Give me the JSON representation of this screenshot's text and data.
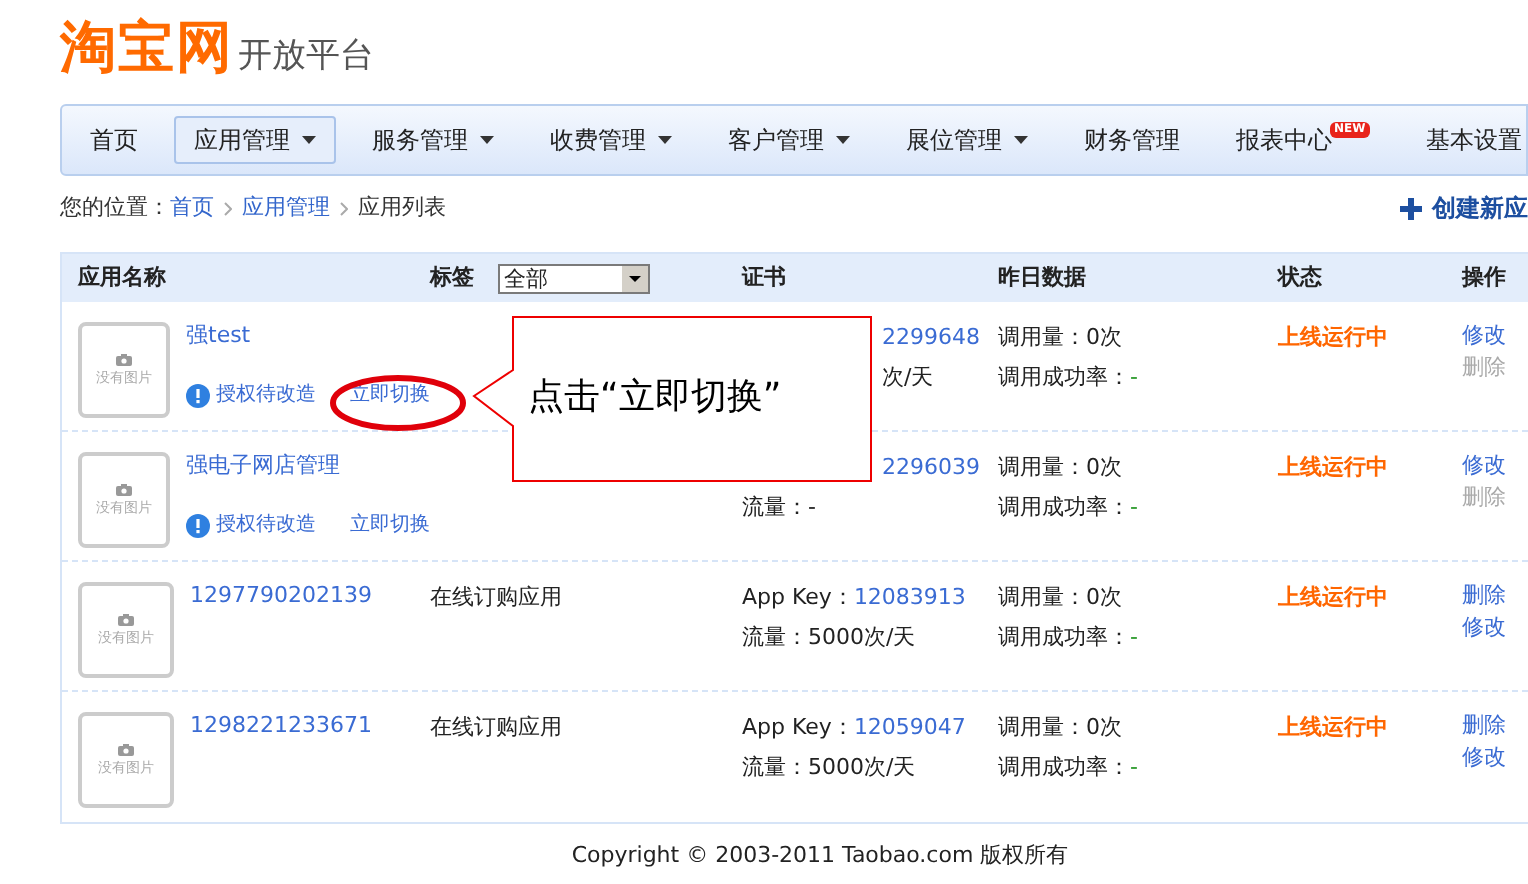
{
  "logo": {
    "brand": "淘宝网",
    "product": "开放平台"
  },
  "nav": [
    {
      "label": "首页",
      "selected": false,
      "dropdown": false
    },
    {
      "label": "应用管理",
      "selected": true,
      "dropdown": true
    },
    {
      "label": "服务管理",
      "selected": false,
      "dropdown": true
    },
    {
      "label": "收费管理",
      "selected": false,
      "dropdown": true
    },
    {
      "label": "客户管理",
      "selected": false,
      "dropdown": true
    },
    {
      "label": "展位管理",
      "selected": false,
      "dropdown": true
    },
    {
      "label": "财务管理",
      "selected": false,
      "dropdown": false
    },
    {
      "label": "报表中心",
      "selected": false,
      "dropdown": false,
      "badge": "NEW"
    },
    {
      "label": "基本设置",
      "selected": false,
      "dropdown": false
    }
  ],
  "breadcrumb": {
    "prefix": "您的位置：",
    "links": [
      "首页",
      "应用管理"
    ],
    "current": "应用列表"
  },
  "create_button": "创建新应",
  "table": {
    "columns": [
      "应用名称",
      "标签",
      "证书",
      "昨日数据",
      "状态",
      "操作"
    ],
    "tag_filter": "全部",
    "rows": [
      {
        "thumb": "没有图片",
        "name": "强test",
        "auth": "授权待改造",
        "switch": "立即切换",
        "cert": {
          "key": "2299648",
          "flow": "次/天"
        },
        "calls": "调用量：0次",
        "rate_label": "调用成功率：",
        "rate": "-",
        "status": "上线运行中",
        "actions": [
          {
            "label": "修改",
            "disabled": false
          },
          {
            "label": "删除",
            "disabled": true
          }
        ]
      },
      {
        "thumb": "没有图片",
        "name": "强电子网店管理",
        "auth": "授权待改造",
        "switch": "立即切换",
        "cert": {
          "key": "2296039",
          "flow_label": "流量：",
          "flow": "-"
        },
        "calls": "调用量：0次",
        "rate_label": "调用成功率：",
        "rate": "-",
        "status": "上线运行中",
        "actions": [
          {
            "label": "修改",
            "disabled": false
          },
          {
            "label": "删除",
            "disabled": true
          }
        ]
      },
      {
        "thumb": "没有图片",
        "name": "1297790202139",
        "tag": "在线订购应用",
        "cert": {
          "key_label": "App Key：",
          "key": "12083913",
          "flow_label": "流量：",
          "flow": "5000次/天"
        },
        "calls": "调用量：0次",
        "rate_label": "调用成功率：",
        "rate": "-",
        "status": "上线运行中",
        "actions": [
          {
            "label": "删除",
            "disabled": false
          },
          {
            "label": "修改",
            "disabled": false
          }
        ]
      },
      {
        "thumb": "没有图片",
        "name": "1298221233671",
        "tag": "在线订购应用",
        "cert": {
          "key_label": "App Key：",
          "key": "12059047",
          "flow_label": "流量：",
          "flow": "5000次/天"
        },
        "calls": "调用量：0次",
        "rate_label": "调用成功率：",
        "rate": "-",
        "status": "上线运行中",
        "actions": [
          {
            "label": "删除",
            "disabled": false
          },
          {
            "label": "修改",
            "disabled": false
          }
        ]
      }
    ]
  },
  "callout": {
    "text": "点击“立即切换”"
  },
  "footer": "Copyright © 2003-2011 Taobao.com 版权所有"
}
